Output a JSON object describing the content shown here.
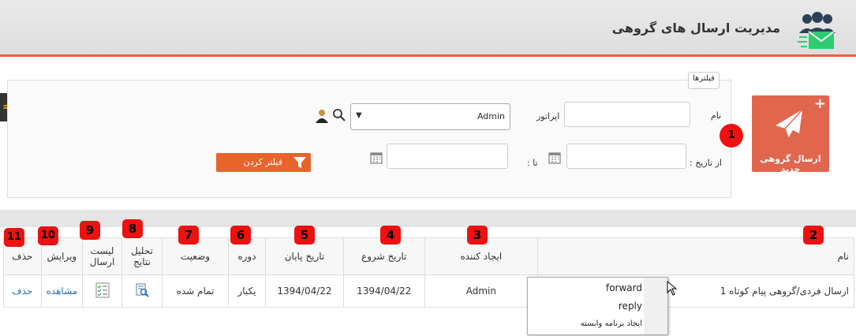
{
  "header": {
    "title": "مدیریت ارسال های گروهی",
    "logo_icon": "group-message-icon"
  },
  "side_tab": {
    "icon": "flag-icon",
    "glyph": "≈"
  },
  "new_button": {
    "label": "ارسال گروهی جدید",
    "plus": "+",
    "icon": "paper-plane-icon"
  },
  "filters": {
    "legend": "فیلترها",
    "name_label": "نام",
    "name_value": "",
    "operator_label": "اپراتور",
    "operator_value": "Admin",
    "operator_caret": "▼",
    "from_date_label": "از تاریخ :",
    "to_date_label": "تا :",
    "from_date_value": "",
    "to_date_value": "",
    "filter_button": "فیلتر کردن"
  },
  "table": {
    "headers": {
      "name": "نام",
      "creator": "ایجاد کننده",
      "start_date": "تاریخ شروع",
      "end_date": "تاریخ پایان",
      "period": "دوره",
      "status": "وضعیت",
      "analysis": "تحلیل نتایج",
      "send_list": "لیست ارسال",
      "edit": "ویرایش",
      "delete": "حذف"
    },
    "rows": [
      {
        "name": "ارسال فردی/گروهی پیام کوتاه 1",
        "creator": "Admin",
        "start_date": "1394/04/22",
        "end_date": "1394/04/22",
        "period": "یکبار",
        "status": "تمام شده",
        "edit": "مشاهده",
        "delete": "حذف"
      }
    ]
  },
  "context_menu": {
    "items": [
      "forward",
      "reply",
      "ایجاد برنامه وابسته"
    ]
  },
  "badges": [
    "1",
    "2",
    "3",
    "4",
    "5",
    "6",
    "7",
    "8",
    "9",
    "10",
    "11"
  ],
  "colors": {
    "accent": "#e8642c",
    "new_button": "#e1664e",
    "badge": "#ee1111",
    "link": "#2a6ebb"
  }
}
